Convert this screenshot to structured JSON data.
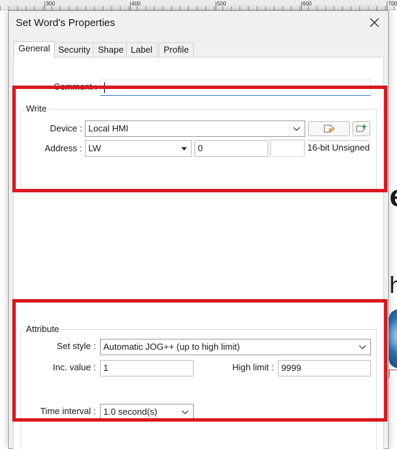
{
  "background": {
    "ruler_marks": [
      "300",
      "400",
      "500",
      "600",
      "700"
    ],
    "glyph_e": "e",
    "glyph_h": "h"
  },
  "dialog": {
    "title": "Set Word's Properties",
    "close_icon": "close-icon",
    "tabs": [
      {
        "label": "General",
        "active": true
      },
      {
        "label": "Security",
        "active": false
      },
      {
        "label": "Shape",
        "active": false
      },
      {
        "label": "Label",
        "active": false
      },
      {
        "label": "Profile",
        "active": false
      }
    ],
    "comment": {
      "label": "Comment :",
      "value": ""
    },
    "write": {
      "title": "Write",
      "device_label": "Device :",
      "device_value": "Local HMI",
      "address_label": "Address :",
      "address_type": "LW",
      "address_value": "0",
      "data_format": "16-bit Unsigned",
      "icons": [
        "tag-settings-icon",
        "add-tag-icon"
      ]
    },
    "attribute": {
      "title": "Attribute",
      "set_style_label": "Set style :",
      "set_style_value": "Automatic JOG++ (up to high limit)",
      "inc_label": "Inc. value :",
      "inc_value": "1",
      "high_limit_label": "High limit :",
      "high_limit_value": "9999",
      "time_interval_label": "Time interval :",
      "time_interval_value": "1.0 second(s)"
    },
    "highlight_color": "#d9191e"
  }
}
